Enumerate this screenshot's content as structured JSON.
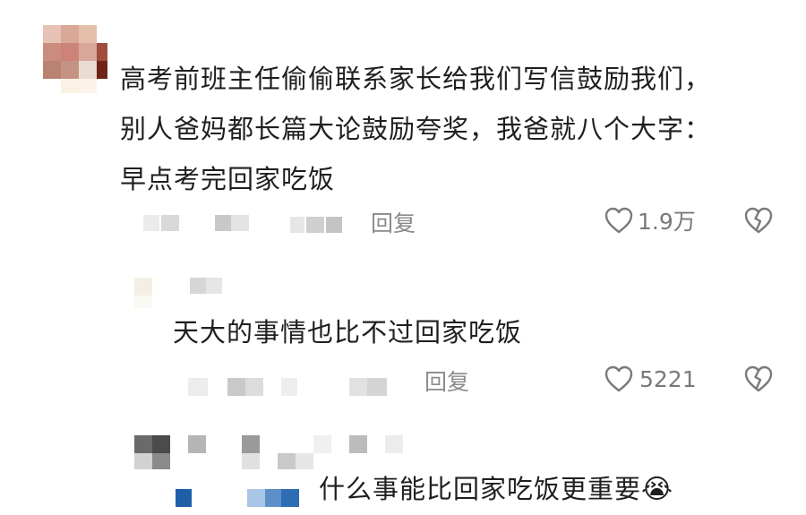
{
  "comment": {
    "lines": [
      "高考前班主任偷偷联系家长给我们写信鼓励我们，",
      "别人爸妈都长篇大论鼓励夸奖，我爸就八个大字：",
      "早点考完回家吃饭"
    ],
    "reply_label": "回复",
    "like_count": "1.9万",
    "like_icon": "heart-outline-icon",
    "dislike_icon": "broken-heart-icon"
  },
  "replies": [
    {
      "text": "天大的事情也比不过回家吃饭",
      "reply_label": "回复",
      "like_count": "5221",
      "like_icon": "heart-outline-icon",
      "dislike_icon": "broken-heart-icon"
    },
    {
      "text": "什么事能比回家吃饭更重要",
      "emoji": "😭"
    }
  ],
  "colors": {
    "text": "#1f1f1f",
    "meta": "#8a8a8a",
    "icon": "#7a7a7a"
  }
}
